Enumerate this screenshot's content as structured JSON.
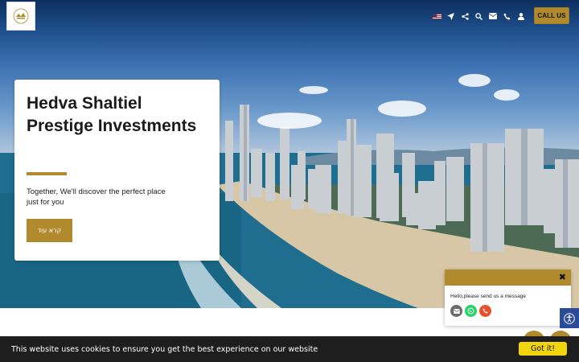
{
  "header": {
    "call_label": "CALL US",
    "icons": [
      "us-flag-icon",
      "navigation-arrow-icon",
      "share-icon",
      "search-icon",
      "envelope-icon",
      "phone-icon",
      "user-icon"
    ]
  },
  "hero": {
    "title": "Hedva Shaltiel Prestige Investments",
    "subtitle": "Together, We'll discover the perfect place just for you",
    "button_label": "קרא עוד"
  },
  "chat": {
    "close_glyph": "✖",
    "message": "Hello,please send us a message"
  },
  "cookie": {
    "text": "This website uses cookies to ensure you get the best experience on our website",
    "button_label": "Got it!"
  },
  "colors": {
    "accent": "#b08a2c",
    "cookie_button": "#f3d50e",
    "cookie_bar": "#1e1e1e",
    "accessibility": "#2a4b96",
    "whatsapp": "#25d366",
    "phone": "#e8502a",
    "email": "#6b6b6b"
  }
}
